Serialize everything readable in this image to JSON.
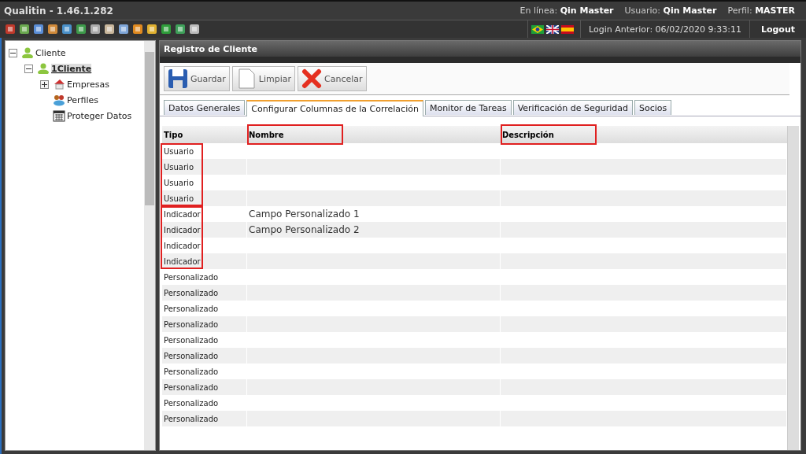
{
  "window": {
    "title": "Qualitin - 1.46.1.282"
  },
  "header": {
    "online_label": "En línea:",
    "online_value": "Qin Master",
    "user_label": "Usuario:",
    "user_value": "Qin Master",
    "profile_label": "Perfil:",
    "profile_value": "MASTER",
    "last_login": "Login Anterior: 06/02/2020 9:33:11",
    "logout": "Logout"
  },
  "tree": [
    {
      "label": "Cliente",
      "expanded": true,
      "selected": false,
      "children": [
        {
          "label": "1Cliente",
          "expanded": true,
          "selected": true,
          "children": [
            {
              "label": "Empresas",
              "expanded": false,
              "selected": false,
              "kind": "expandable"
            },
            {
              "label": "Perfiles",
              "selected": false,
              "kind": "leaf"
            },
            {
              "label": "Proteger Datos",
              "selected": false,
              "kind": "leaf"
            }
          ]
        }
      ]
    }
  ],
  "panel": {
    "title": "Registro de Cliente",
    "buttons": [
      {
        "label": "Guardar",
        "kind": "save"
      },
      {
        "label": "Limpiar",
        "kind": "clear"
      },
      {
        "label": "Cancelar",
        "kind": "cancel"
      }
    ],
    "tabs": [
      {
        "label": "Datos Generales",
        "selected": false
      },
      {
        "label": "Configurar Columnas de la Correlación",
        "selected": true
      },
      {
        "label": "Monitor de Tareas",
        "selected": false
      },
      {
        "label": "Verificación de Seguridad",
        "selected": false
      },
      {
        "label": "Socios",
        "selected": false
      }
    ]
  },
  "table": {
    "columns": [
      {
        "label": "Tipo",
        "highlighted": false
      },
      {
        "label": "Nombre",
        "highlighted": true
      },
      {
        "label": "Descripción",
        "highlighted": true
      }
    ],
    "row_groups": [
      {
        "highlighted": true,
        "rows": [
          {
            "tipo": "Usuario"
          },
          {
            "tipo": "Usuario"
          },
          {
            "tipo": "Usuario"
          },
          {
            "tipo": "Usuario"
          }
        ]
      },
      {
        "highlighted": true,
        "rows": [
          {
            "tipo": "Indicador",
            "nombre": "Campo Personalizado 1"
          },
          {
            "tipo": "Indicador",
            "nombre": "Campo Personalizado 2"
          },
          {
            "tipo": "Indicador"
          },
          {
            "tipo": "Indicador"
          }
        ]
      },
      {
        "highlighted": false,
        "rows": [
          {
            "tipo": "Personalizado"
          },
          {
            "tipo": "Personalizado"
          },
          {
            "tipo": "Personalizado"
          },
          {
            "tipo": "Personalizado"
          },
          {
            "tipo": "Personalizado"
          },
          {
            "tipo": "Personalizado"
          },
          {
            "tipo": "Personalizado"
          },
          {
            "tipo": "Personalizado"
          },
          {
            "tipo": "Personalizado"
          },
          {
            "tipo": "Personalizado"
          }
        ]
      }
    ]
  }
}
